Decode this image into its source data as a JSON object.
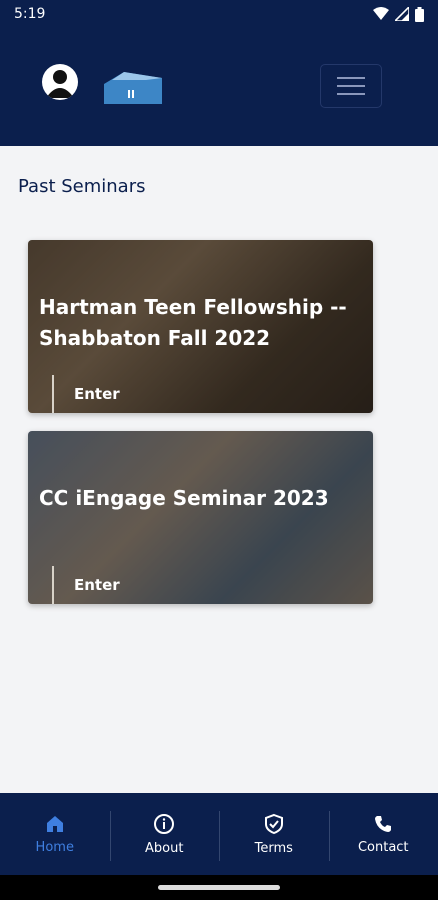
{
  "status_bar": {
    "time": "5:19"
  },
  "header": {
    "menu_icon": "hamburger-icon",
    "avatar_icon": "user-avatar-icon",
    "logo_icon": "building-logo-icon"
  },
  "section": {
    "title": "Past Seminars"
  },
  "seminars": [
    {
      "title": "Hartman Teen Fellowship -- Shabbaton Fall 2022",
      "action": "Enter"
    },
    {
      "title": "CC iEngage Seminar 2023",
      "action": "Enter"
    }
  ],
  "bottom_nav": [
    {
      "label": "Home",
      "icon": "home-icon",
      "active": true
    },
    {
      "label": "About",
      "icon": "info-icon",
      "active": false
    },
    {
      "label": "Terms",
      "icon": "shield-check-icon",
      "active": false
    },
    {
      "label": "Contact",
      "icon": "phone-icon",
      "active": false
    }
  ],
  "colors": {
    "primary": "#0b1f4d",
    "active": "#3f7fe0",
    "background": "#f3f4f6"
  }
}
